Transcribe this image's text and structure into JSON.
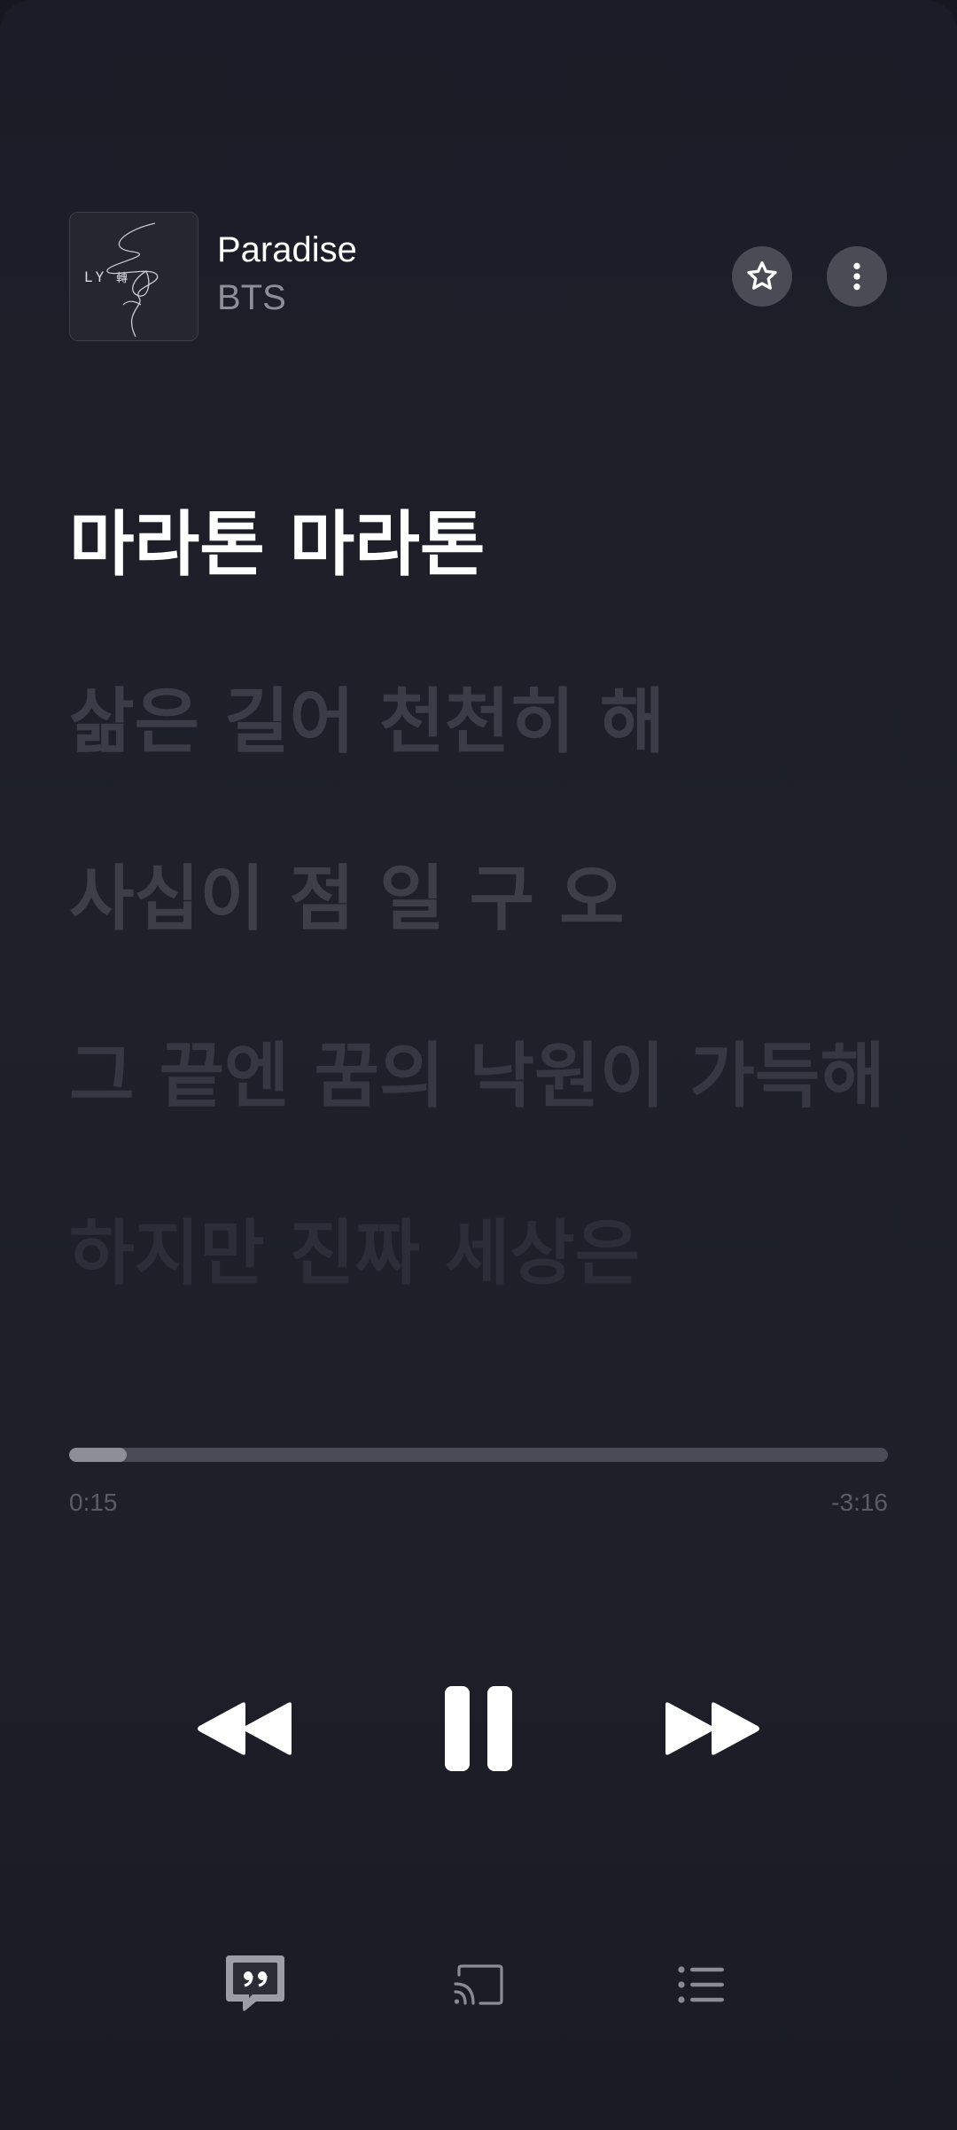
{
  "now_playing": {
    "title": "Paradise",
    "artist": "BTS",
    "album_art_text": "LY 轉"
  },
  "header_buttons": {
    "favorite_icon": "star-outline-icon",
    "more_icon": "vertical-dots-icon"
  },
  "lyrics": [
    "마라톤 마라톤",
    "삶은 길어 천천히 해",
    "사십이 점 일 구 오",
    "그 끝엔 꿈의 낙원이 가득해",
    "하지만 진짜 세상은"
  ],
  "playback": {
    "elapsed": "0:15",
    "remaining": "-3:16",
    "progress_fraction": 0.07
  },
  "controls": {
    "rewind_icon": "rewind-icon",
    "pause_icon": "pause-icon",
    "forward_icon": "fast-forward-icon"
  },
  "bottom_bar": {
    "lyrics_icon": "lyrics-quote-icon",
    "cast_icon": "cast-icon",
    "queue_icon": "queue-list-icon"
  },
  "colors": {
    "background": "#1e1f29",
    "active_lyric": "#ffffff",
    "inactive_lyric": "#3b3c47",
    "progress_track": "#4a4b56",
    "progress_fill": "#8d8e97"
  }
}
